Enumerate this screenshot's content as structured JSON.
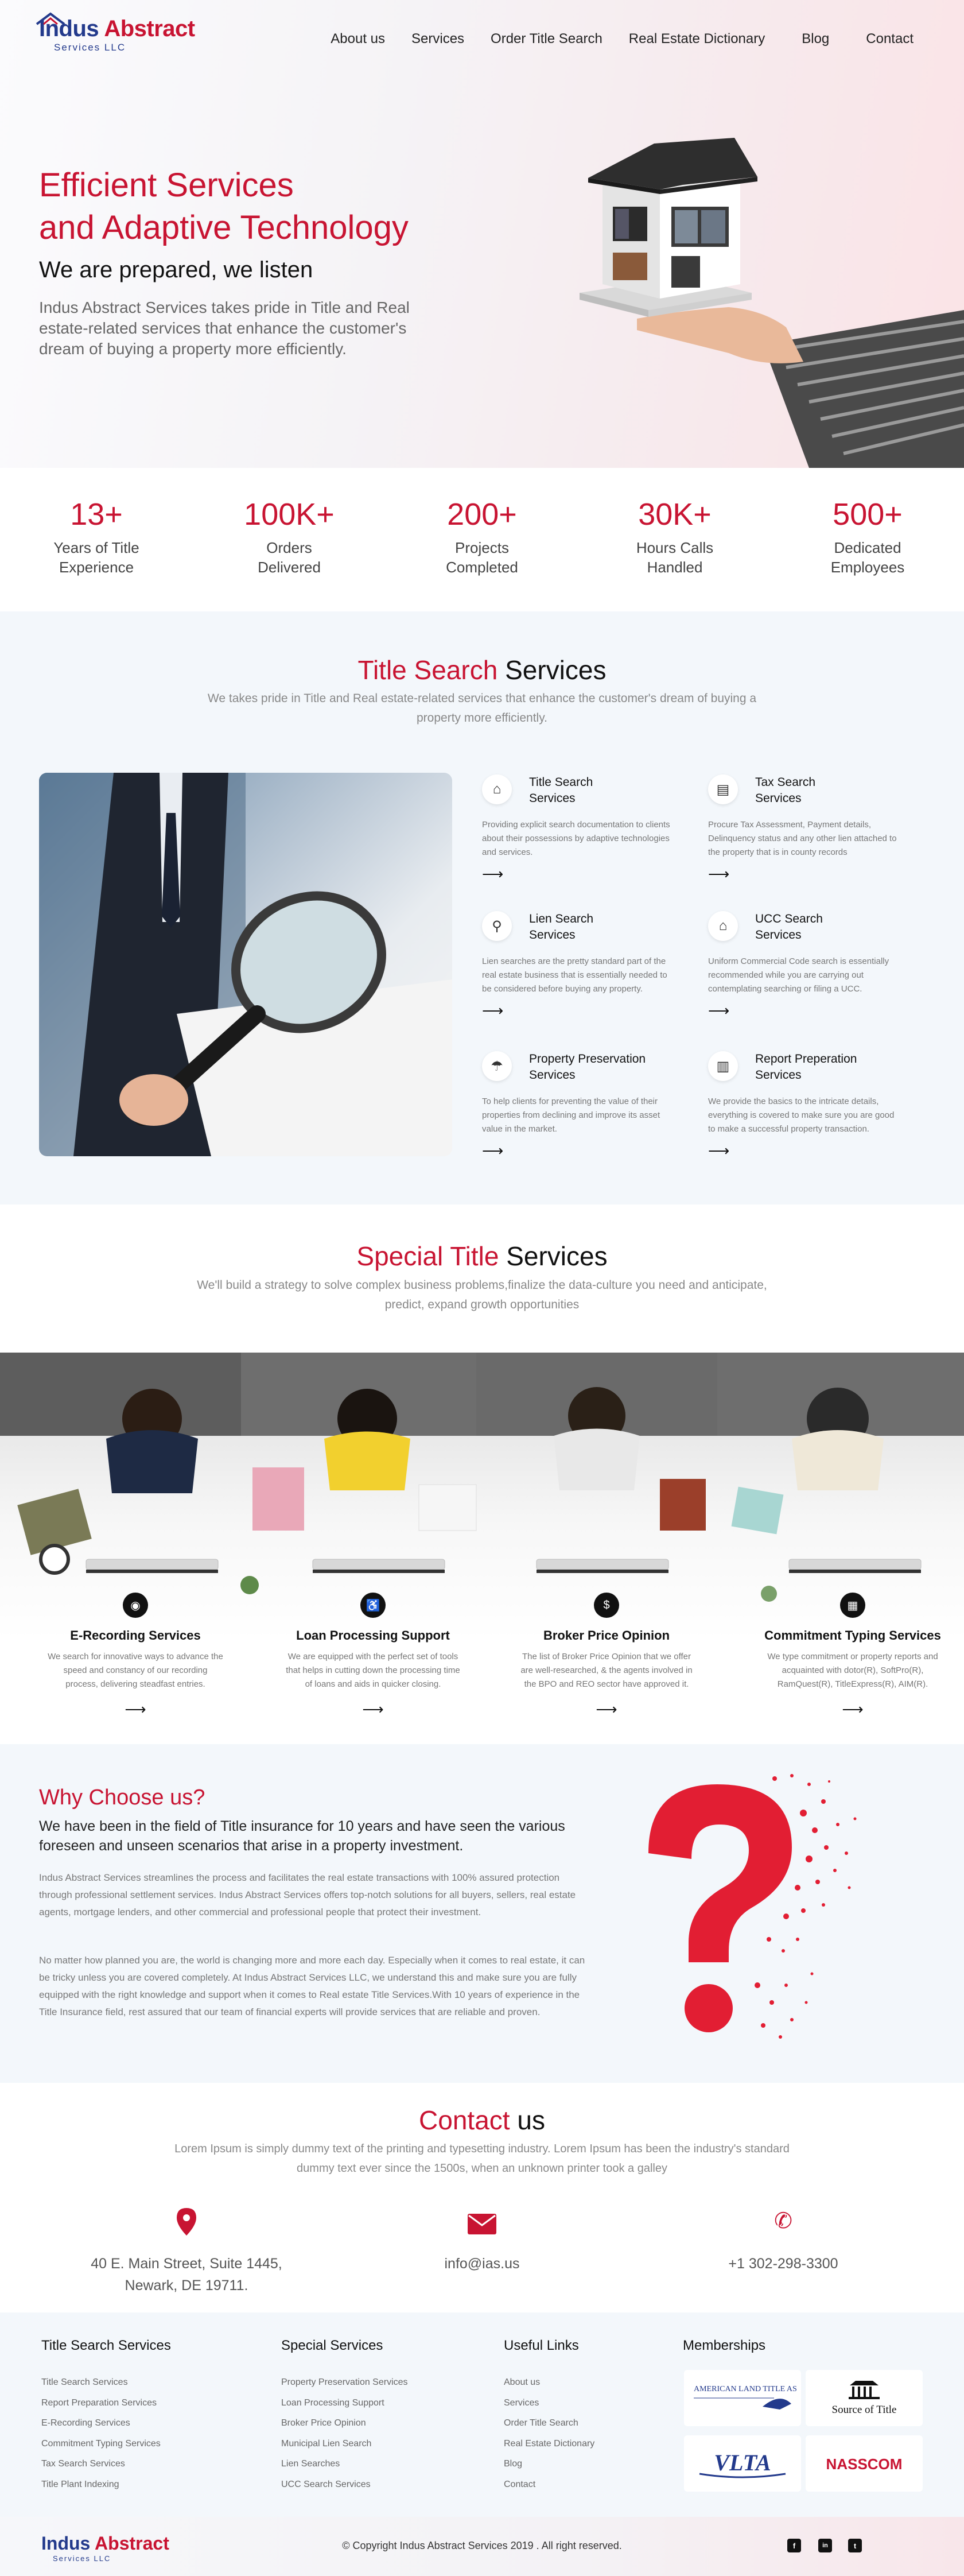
{
  "brand": {
    "name_first": "Indus",
    "name_second": "Abstract",
    "subtitle": "Services LLC",
    "red": "#c81432",
    "navy": "#233a8c"
  },
  "nav": [
    "About us",
    "Services",
    "Order Title Search",
    "Real Estate Dictionary",
    "Blog",
    "Contact"
  ],
  "hero": {
    "headline_line1": "Efficient Services",
    "headline_line2": "and Adaptive Technology",
    "subheadline": "We are prepared, we listen",
    "body": "Indus Abstract Services takes pride in Title and Real estate-related services that enhance the customer's dream of buying a property more efficiently."
  },
  "stats": [
    {
      "value": "13+",
      "label": "Years of Title\nExperience"
    },
    {
      "value": "100K+",
      "label": "Orders\nDelivered"
    },
    {
      "value": "200+",
      "label": "Projects\nCompleted"
    },
    {
      "value": "30K+",
      "label": "Hours Calls\nHandled"
    },
    {
      "value": "500+",
      "label": "Dedicated\nEmployees"
    }
  ],
  "title_search": {
    "title_red": "Title Search",
    "title_rest": "Services",
    "description": "We takes pride in Title and Real estate-related services that enhance the customer's dream of buying a property more efficiently.",
    "services": [
      {
        "icon": "house-search-icon",
        "name": "Title Search\nServices",
        "text": "Providing explicit search documentation to clients about their possessions by adaptive technologies and services."
      },
      {
        "icon": "tax-document-icon",
        "name": "Tax Search\nServices",
        "text": "Procure Tax Assessment, Payment details, Delinquency status and any other lien attached to the property that is in county records"
      },
      {
        "icon": "lien-search-icon",
        "name": "Lien Search\nServices",
        "text": "Lien searches are the pretty standard part of the real estate business that is essentially needed to be considered before buying any property."
      },
      {
        "icon": "ucc-house-icon",
        "name": "UCC Search\nServices",
        "text": "Uniform Commercial Code search is essentially recommended while you are carrying out contemplating searching or filing a UCC."
      },
      {
        "icon": "property-preservation-icon",
        "name": "Property Preservation\nServices",
        "text": "To help clients for preventing the value of their properties from declining and improve its asset value in the market."
      },
      {
        "icon": "report-chart-icon",
        "name": "Report Preperation\nServices",
        "text": "We provide the basics to the intricate details, everything is covered to make sure you are good to make a successful property transaction."
      }
    ],
    "arrow": "⟶"
  },
  "special": {
    "title_red": "Special Title",
    "title_rest": "Services",
    "description": "We'll build a strategy to solve complex business problems,finalize the data-culture you need and anticipate, predict, expand growth opportunities",
    "services": [
      {
        "icon": "globe-icon",
        "name": "E-Recording Services",
        "text": "We search for innovative ways to advance the speed and constancy of our recording process, delivering steadfast entries."
      },
      {
        "icon": "loan-icon",
        "name": "Loan Processing Support",
        "text": "We are equipped with the perfect set of tools that helps in cutting down the processing time of loans and aids in quicker closing."
      },
      {
        "icon": "hand-money-icon",
        "name": "Broker Price Opinion",
        "text": "The list of Broker Price Opinion that we offer are well-researched, & the agents involved in the BPO and REO sector have approved it."
      },
      {
        "icon": "register-icon",
        "name": "Commitment Typing Services",
        "text": "We type commitment or property reports and acquainted with dotor(R), SoftPro(R), RamQuest(R), TitleExpress(R), AIM(R)."
      }
    ]
  },
  "why": {
    "title": "Why Choose us?",
    "lead": "We have been in the field of Title insurance for 10 years and have seen the various foreseen and unseen scenarios that arise in a property investment.",
    "para1": "Indus Abstract Services streamlines the process and facilitates the real estate transactions with 100% assured protection through professional settlement services. Indus Abstract Services offers top-notch solutions for all buyers, sellers, real estate agents, mortgage lenders, and other commercial and professional people that protect their investment.",
    "para2": "No matter how planned you are, the world is changing more and more each day. Especially when it comes to real estate, it can be tricky unless you are covered completely. At Indus Abstract Services LLC, we understand this and make sure you are fully equipped with the right knowledge and support when it comes to Real estate Title Services.With 10 years of experience in the Title Insurance field, rest assured that our team of financial experts will provide services that are reliable and proven."
  },
  "contact": {
    "title_red": "Contact",
    "title_rest": "us",
    "description": "Lorem Ipsum is simply dummy text of the printing and typesetting industry. Lorem Ipsum has been the industry's standard dummy text ever since the 1500s, when an unknown printer took a galley",
    "address": "40 E. Main Street, Suite 1445,\nNewark, DE 19711.",
    "email": "info@ias.us",
    "phone": "+1 302-298-3300"
  },
  "footer": {
    "col1_title": "Title Search Services",
    "col1_links": [
      "Title Search Services",
      "Report Preparation Services",
      "E-Recording Services",
      "Commitment Typing Services",
      "Tax Search Services",
      "Title Plant Indexing"
    ],
    "col2_title": "Special Services",
    "col2_links": [
      "Property Preservation Services",
      "Loan Processing Support",
      "Broker Price Opinion",
      "Municipal Lien Search",
      "Lien Searches",
      "UCC Search Services"
    ],
    "col3_title": "Useful Links",
    "col3_links": [
      "About us",
      "Services",
      "Order Title Search",
      "Real Estate Dictionary",
      "Blog",
      "Contact"
    ],
    "col4_title": "Memberships",
    "memberships": [
      "AMERICAN LAND TITLE ASSOCIATION",
      "Source of Title",
      "VLTA",
      "NASSCOM"
    ],
    "copyright": "© Copyright Indus Abstract Services 2019 . All right reserved.",
    "social": [
      "f",
      "in",
      "t"
    ]
  }
}
